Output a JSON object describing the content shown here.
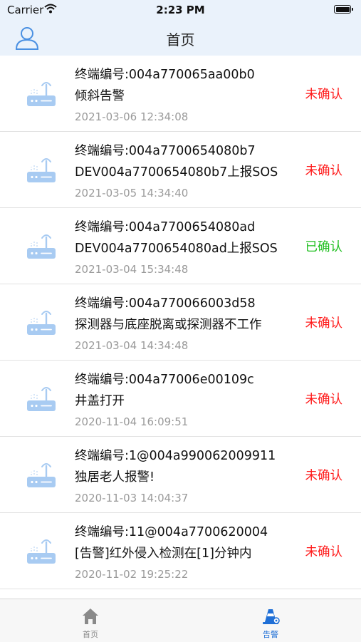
{
  "status_bar": {
    "carrier": "Carrier",
    "time": "2:23 PM"
  },
  "header": {
    "title": "首页"
  },
  "colors": {
    "unconfirmed": "#ff1a1a",
    "confirmed": "#1fbf1f",
    "accent": "#1f6fd6"
  },
  "alarms": [
    {
      "terminal": "终端编号:004a770065aa00b0",
      "message": "倾斜告警",
      "time": "2021-03-06 12:34:08",
      "status": "未确认",
      "confirmed": false
    },
    {
      "terminal": "终端编号:004a7700654080b7",
      "message": "DEV004a7700654080b7上报SOS",
      "time": "2021-03-05 14:34:40",
      "status": "未确认",
      "confirmed": false
    },
    {
      "terminal": "终端编号:004a7700654080ad",
      "message": "DEV004a7700654080ad上报SOS",
      "time": "2021-03-04 15:34:48",
      "status": "已确认",
      "confirmed": true
    },
    {
      "terminal": "终端编号:004a770066003d58",
      "message": "探测器与底座脱离或探测器不工作",
      "time": "2021-03-04 14:34:48",
      "status": "未确认",
      "confirmed": false
    },
    {
      "terminal": "终端编号:004a77006e00109c",
      "message": "井盖打开",
      "time": "2020-11-04 16:09:51",
      "status": "未确认",
      "confirmed": false
    },
    {
      "terminal": "终端编号:1@004a990062009911",
      "message": "独居老人报警!",
      "time": "2020-11-03 14:04:37",
      "status": "未确认",
      "confirmed": false
    },
    {
      "terminal": "终端编号:11@004a7700620004",
      "message": "[告警]红外侵入检测在[1]分钟内",
      "time": "2020-11-02 19:25:22",
      "status": "未确认",
      "confirmed": false
    }
  ],
  "tabs": [
    {
      "label": "首页",
      "icon": "home-icon",
      "active": false
    },
    {
      "label": "告警",
      "icon": "alarm-cone-icon",
      "active": true
    }
  ]
}
